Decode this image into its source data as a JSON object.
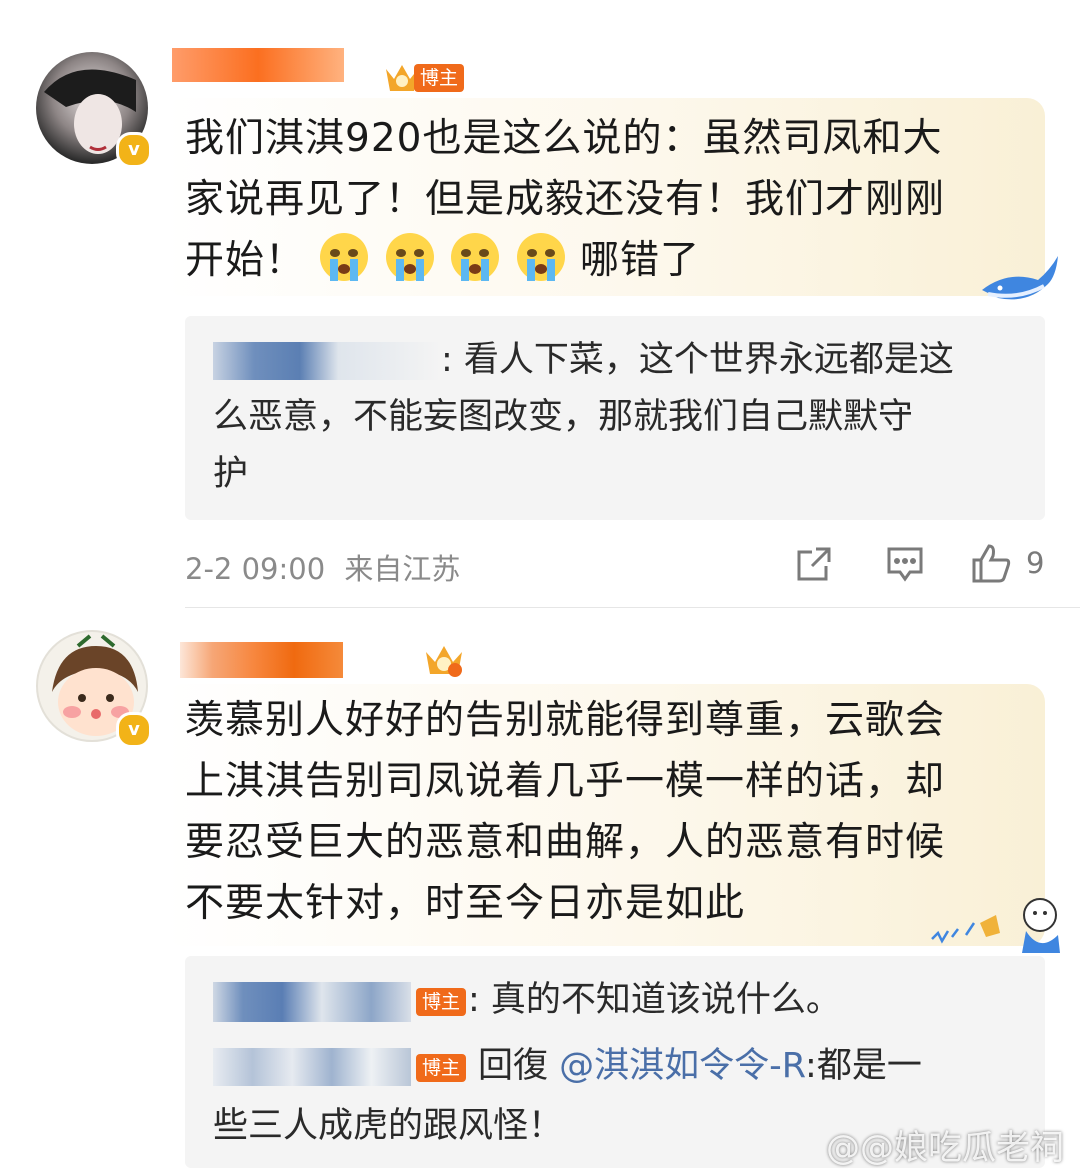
{
  "comments": [
    {
      "badge": "博主",
      "text_lines": [
        "我们淇淇920也是这么说的：虽然司凤和大",
        "家说再见了！但是成毅还没有！我们才刚刚",
        "开始！"
      ],
      "text_tail": "哪错了",
      "emoji_names": [
        "crying-face-emoji",
        "crying-face-emoji",
        "crying-face-emoji",
        "crying-face-emoji"
      ],
      "reply_lines": [
        ": 看人下菜，这个世界永远都是这",
        "么恶意，不能妄图改变，那就我们自己默默守",
        "护"
      ],
      "timestamp": "2-2 09:00",
      "location": "来自江苏",
      "like_count": "9"
    },
    {
      "text_lines": [
        "羡慕别人好好的告别就能得到尊重，云歌会",
        "上淇淇告别司凤说着几乎一模一样的话，却",
        "要忍受巨大的恶意和曲解，人的恶意有时候",
        "不要太针对，时至今日亦是如此"
      ],
      "replies": [
        {
          "badge": "博主",
          "text": ": 真的不知道该说什么。"
        },
        {
          "badge": "博主",
          "reply_word": "回復",
          "mention": "@淇淇如令令-R",
          "text_after": ":都是一",
          "line2": "些三人成虎的跟风怪！"
        }
      ]
    }
  ],
  "watermark": "@@娘吃瓜老祠",
  "colors": {
    "badge_orange": "#f06a1a",
    "verified_gold": "#f2b318",
    "mention_blue": "#4a6fa8",
    "meta_gray": "#8a8a8a"
  }
}
